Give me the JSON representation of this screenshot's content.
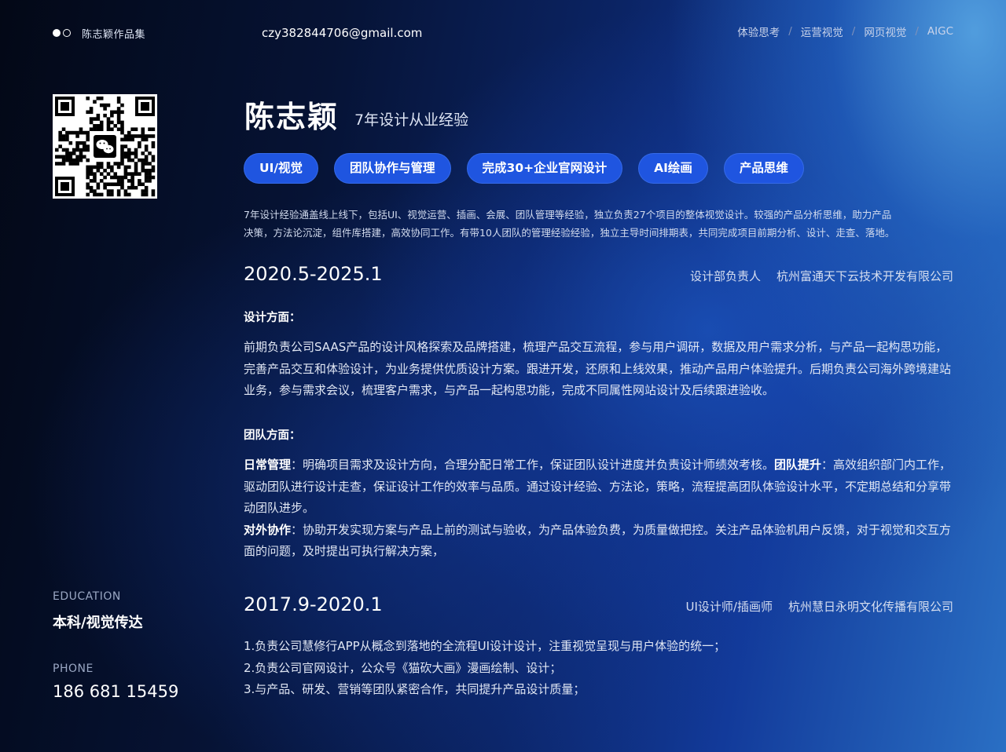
{
  "header": {
    "portfolio_title": "陈志颖作品集",
    "email": "czy382844706@gmail.com",
    "nav": [
      "体验思考",
      "运营视觉",
      "网页视觉",
      "AIGC"
    ],
    "nav_separator": "/"
  },
  "profile": {
    "name": "陈志颖",
    "experience": "7年设计从业经验",
    "tags": [
      "UI/视觉",
      "团队协作与管理",
      "完成30+企业官网设计",
      "AI绘画",
      "产品思维"
    ],
    "summary_line1": "7年设计经验通盖线上线下，包括UI、视觉运营、插画、会展、团队管理等经验，独立负责27个项目的整体视觉设计。较强的产品分析思维，助力产品",
    "summary_line2": "决策，方法论沉淀，组件库搭建，高效协同工作。有带10人团队的管理经验经验，独立主导时间排期表，共同完成项目前期分析、设计、走查、落地。"
  },
  "jobs": [
    {
      "period": "2020.5-2025.1",
      "role": "设计部负责人",
      "company": "杭州富通天下云技术开发有限公司",
      "design_heading": "设计方面：",
      "design_text": "前期负责公司SAAS产品的设计风格探索及品牌搭建，梳理产品交互流程，参与用户调研，数据及用户需求分析，与产品一起构思功能，完善产品交互和体验设计，为业务提供优质设计方案。跟进开发，还原和上线效果，推动产品用户体验提升。后期负责公司海外跨境建站业务，参与需求会议，梳理客户需求，与产品一起构思功能，完成不同属性网站设计及后续跟进验收。",
      "team_heading": "团队方面：",
      "daily_label": "日常管理",
      "daily_text": "：明确项目需求及设计方向，合理分配日常工作，保证团队设计进度并负责设计师绩效考核。",
      "improve_label": "团队提升",
      "improve_text": "：高效组织部门内工作，驱动团队进行设计走查，保证设计工作的效率与品质。通过设计经验、方法论，策略，流程提高团队体验设计水平，不定期总结和分享带动团队进步。",
      "collab_label": "对外协作",
      "collab_text": "：协助开发实现方案与产品上前的测试与验收，为产品体验负费，为质量做把控。关注产品体验机用户反馈，对于视觉和交互方面的问题，及时提出可执行解决方案，"
    },
    {
      "period": "2017.9-2020.1",
      "role": "UI设计师/插画师",
      "company": "杭州慧日永明文化传播有限公司",
      "items": [
        "1.负责公司慧修行APP从概念到落地的全流程UI设计设计，注重视觉呈现与用户体验的统一；",
        "2.负责公司官网设计，公众号《猫砍大画》漫画绘制、设计；",
        "3.与产品、研发、营销等团队紧密合作，共同提升产品设计质量；"
      ]
    }
  ],
  "sidebar": {
    "education_label": "EDUCATION",
    "education_value": "本科/视觉传达",
    "phone_label": "PHONE",
    "phone_value": "186 681 15459"
  },
  "icons": {
    "qr": "wechat-qr-code-icon",
    "wechat": "wechat-logo-icon"
  }
}
